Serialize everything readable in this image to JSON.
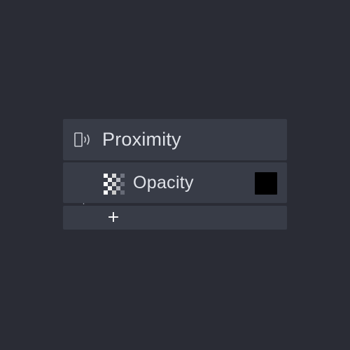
{
  "panel": {
    "header": {
      "icon": "proximity-icon",
      "label": "Proximity"
    },
    "items": [
      {
        "icon": "checkerboard-opacity-icon",
        "label": "Opacity",
        "color": "#000000"
      }
    ],
    "add_button": {
      "icon": "plus-icon",
      "label": "+"
    }
  },
  "colors": {
    "background": "#2a2c35",
    "row": "#383c47",
    "text": "#dfe2e8",
    "tree_line": "#8a8d96"
  }
}
